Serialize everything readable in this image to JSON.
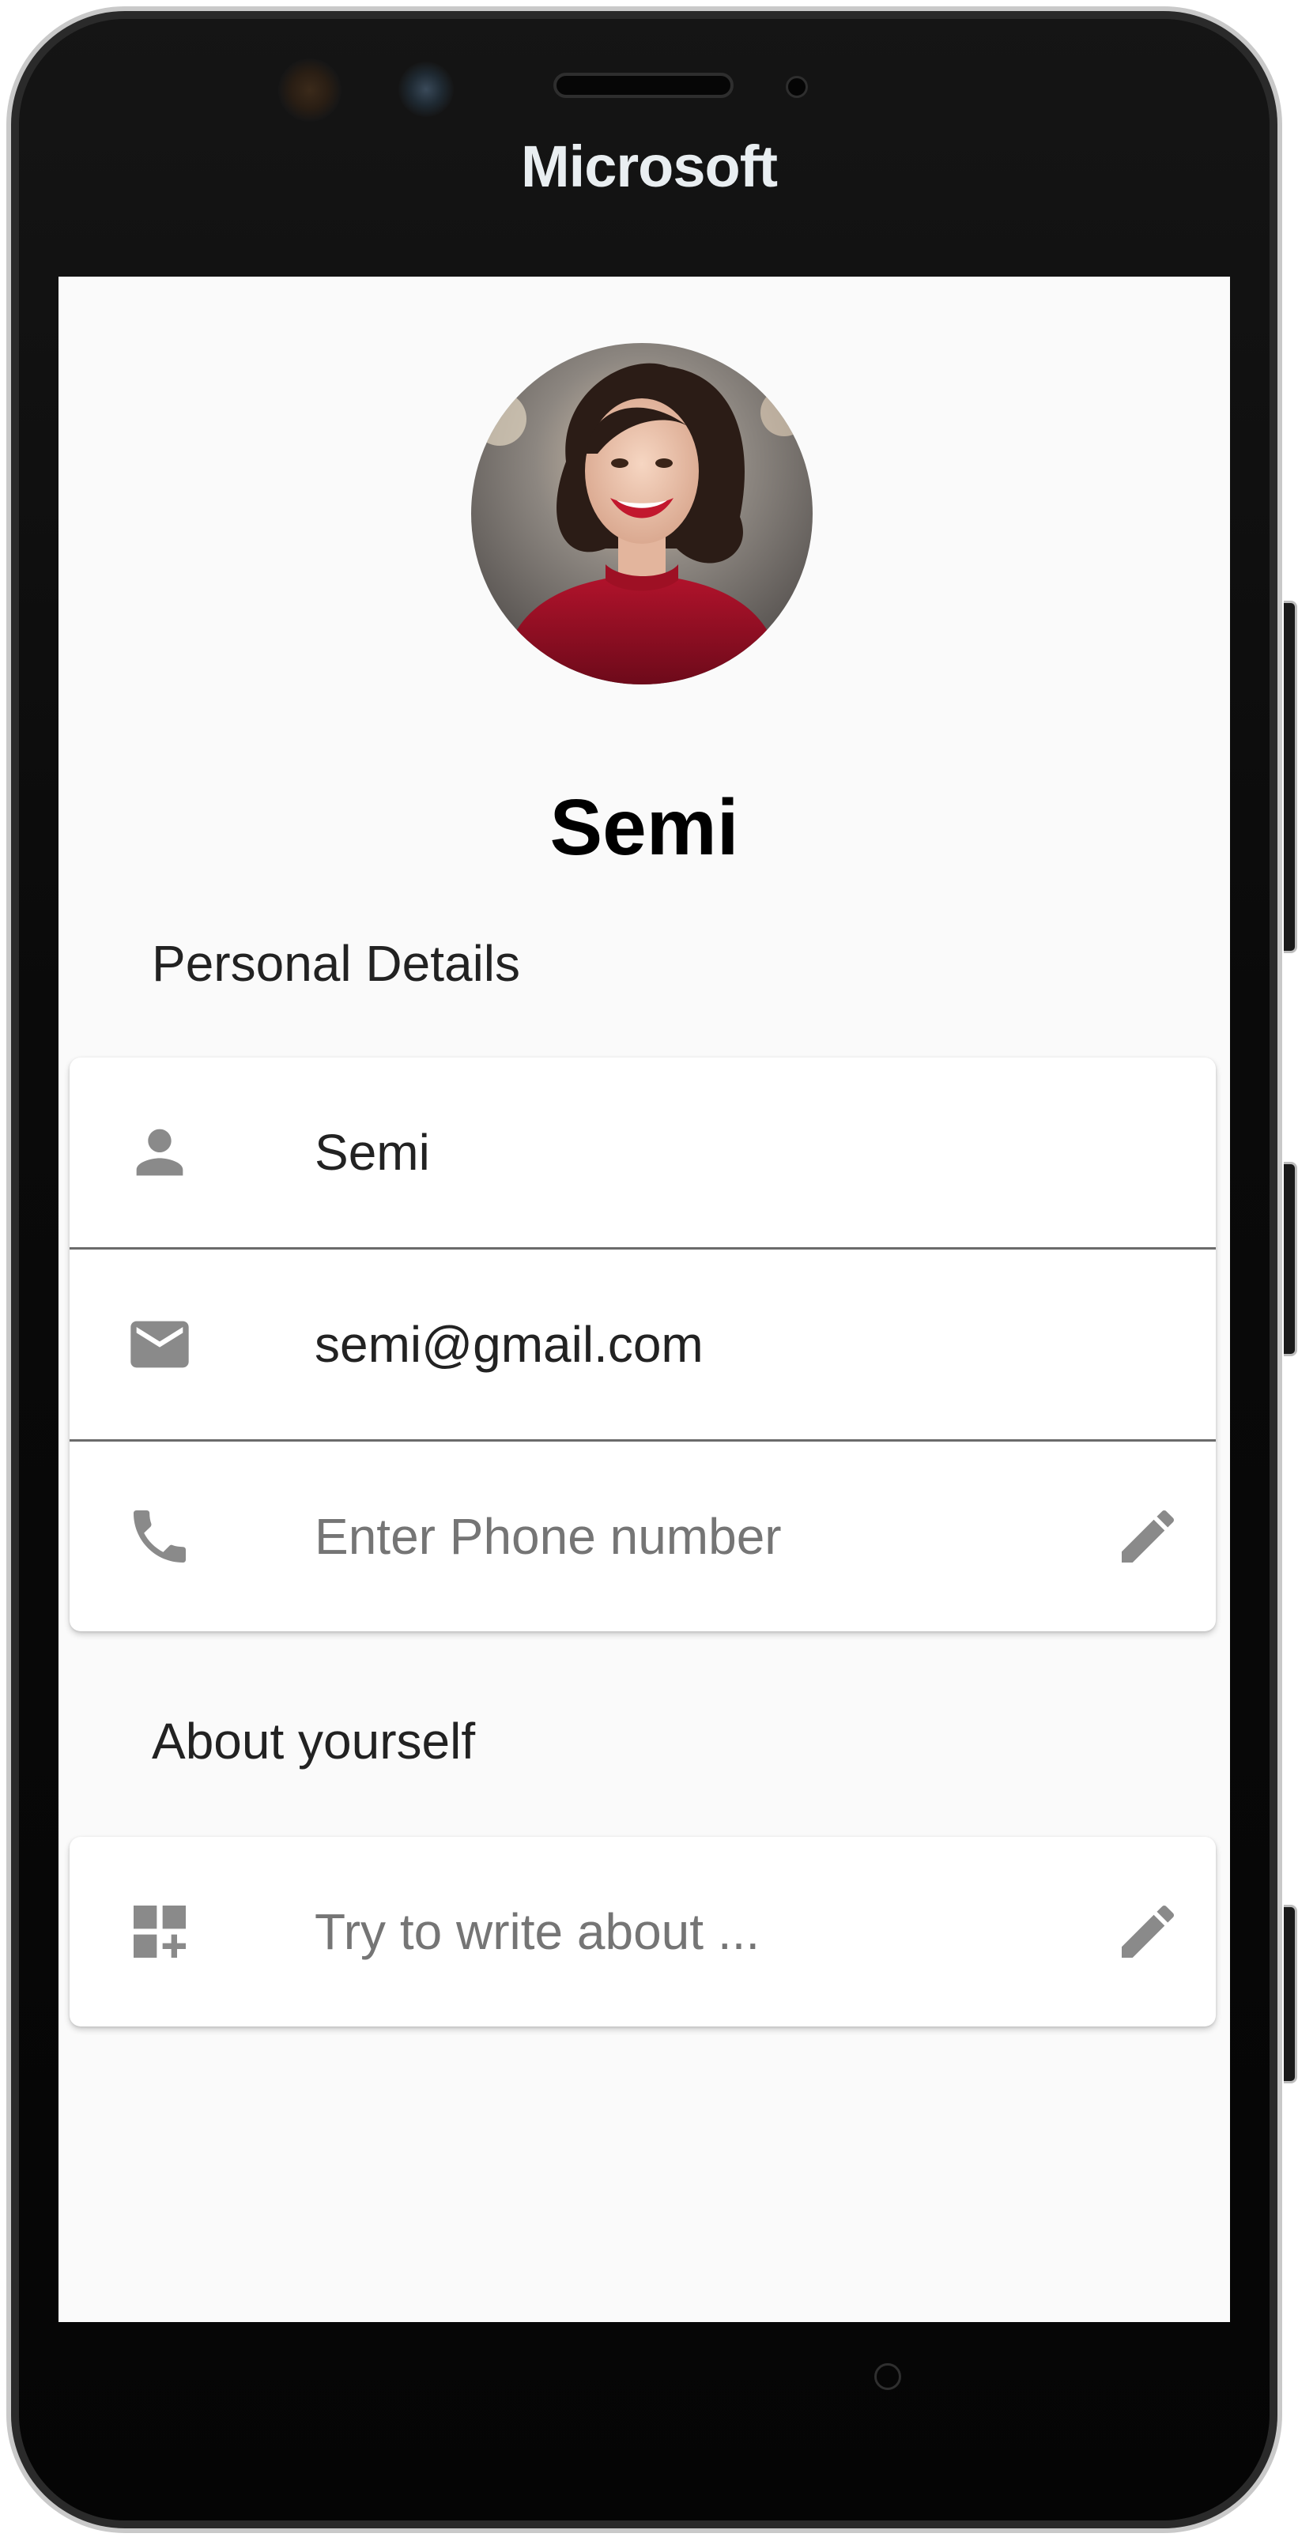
{
  "device": {
    "brand": "Microsoft"
  },
  "profile": {
    "name": "Semi"
  },
  "personal_details": {
    "title": "Personal Details",
    "name_value": "Semi",
    "email_value": "semi@gmail.com",
    "phone_placeholder": "Enter Phone number"
  },
  "about": {
    "title": "About yourself",
    "placeholder": "Try to write about ..."
  },
  "icons": {
    "name": "person-icon",
    "email": "mail-icon",
    "phone": "phone-icon",
    "about": "dashboard-add-icon",
    "edit": "pencil-icon"
  },
  "colors": {
    "icon": "#8a8a8a",
    "text": "#222222",
    "placeholder": "#757575",
    "screen_bg": "#fafafa"
  }
}
